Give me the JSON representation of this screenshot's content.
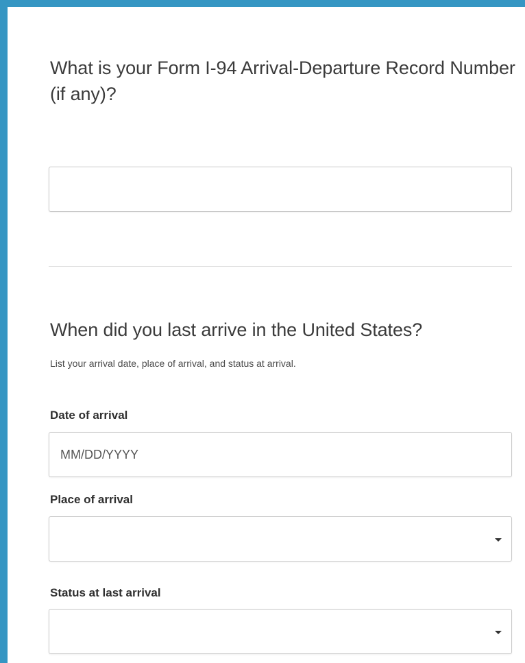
{
  "i94_section": {
    "question": "What is your Form I-94 Arrival-Departure Record Number (if any)?",
    "input_value": "",
    "input_placeholder": ""
  },
  "arrival_section": {
    "question": "When did you last arrive in the United States?",
    "hint": "List your arrival date, place of arrival, and status at arrival.",
    "date_label": "Date of arrival",
    "date_placeholder": "MM/DD/YYYY",
    "date_value": "",
    "place_label": "Place of arrival",
    "place_selected": "",
    "status_label": "Status at last arrival",
    "status_selected": ""
  },
  "colors": {
    "accent_border": "#3596c3",
    "field_border": "#c9c9c9"
  },
  "icons": {
    "select_caret": "caret-down-icon"
  }
}
